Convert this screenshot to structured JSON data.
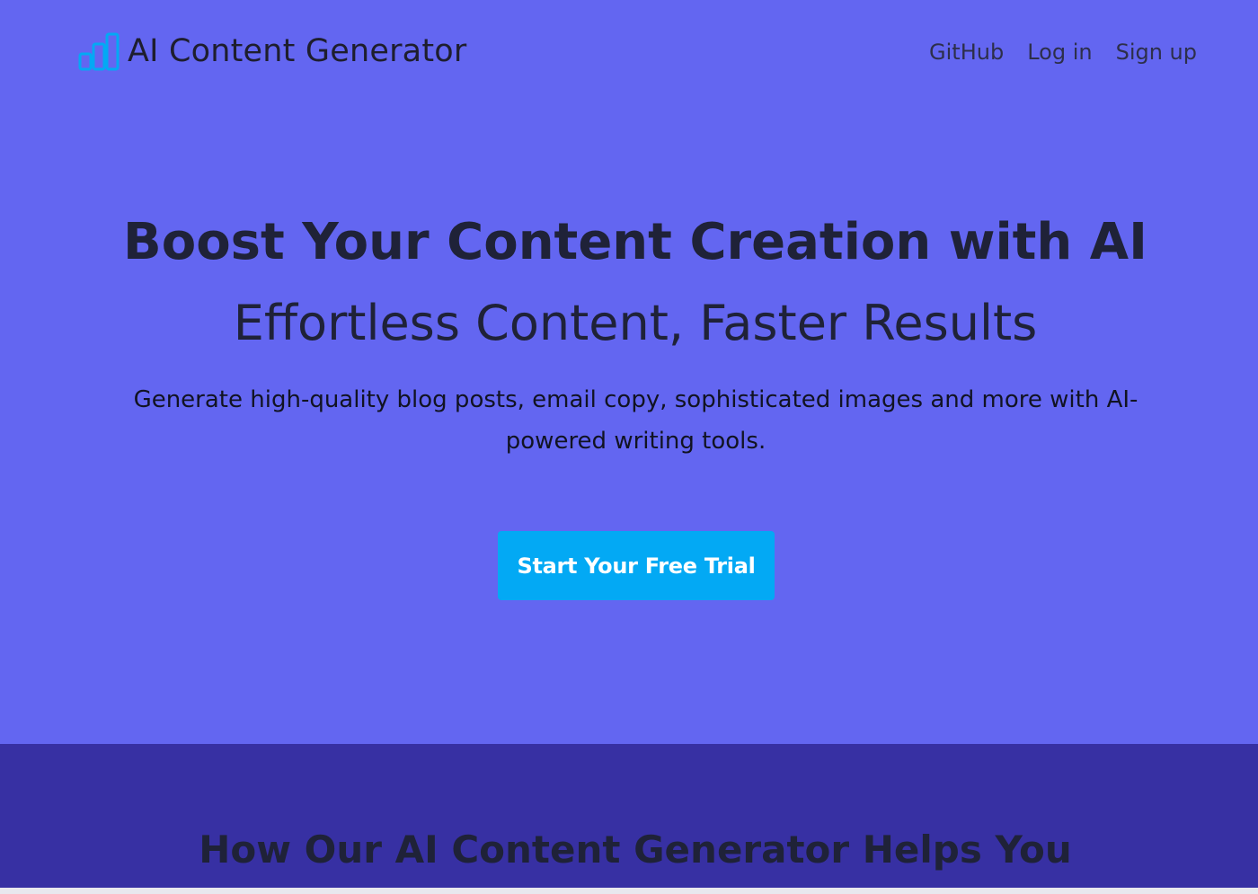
{
  "colors": {
    "hero_bg": "#6366f1",
    "features_bg": "#3730a3",
    "cta_bg": "#03a9f4",
    "logo_icon": "#03a9f4",
    "text_dark": "#1f2238"
  },
  "navbar": {
    "logo_icon": "bar-chart-icon",
    "brand_title": "AI Content Generator",
    "links": [
      {
        "label": "GitHub"
      },
      {
        "label": "Log in"
      },
      {
        "label": "Sign up"
      }
    ]
  },
  "hero": {
    "title": "Boost Your Content Creation with AI",
    "subtitle": "Effortless Content, Faster Results",
    "description": "Generate high-quality blog posts, email copy, sophisticated images and more with AI-powered writing tools.",
    "cta_label": "Start Your Free Trial"
  },
  "features": {
    "title": "How Our AI Content Generator Helps You"
  }
}
